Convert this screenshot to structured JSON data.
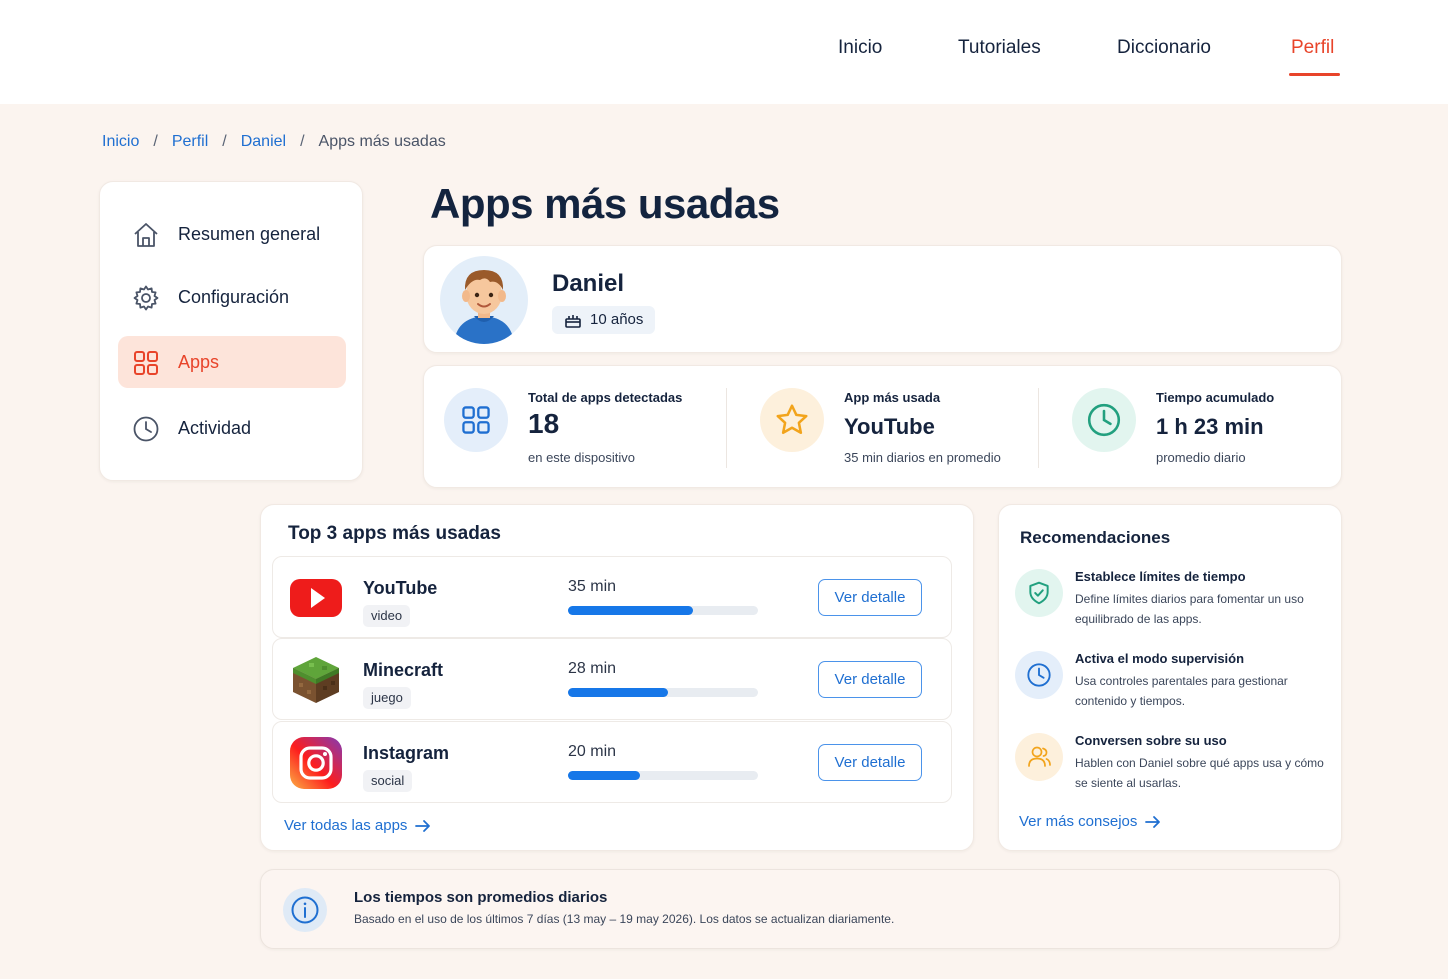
{
  "nav": {
    "items": [
      {
        "label": "Inicio"
      },
      {
        "label": "Tutoriales"
      },
      {
        "label": "Diccionario"
      },
      {
        "label": "Perfil",
        "active": true
      }
    ]
  },
  "breadcrumb": {
    "items": [
      "Inicio",
      "Perfil",
      "Daniel"
    ],
    "current": "Apps más usadas",
    "separator": "/"
  },
  "sidebar": {
    "items": [
      {
        "label": "Resumen general",
        "icon": "home-icon"
      },
      {
        "label": "Configuración",
        "icon": "gear-icon"
      },
      {
        "label": "Apps",
        "icon": "apps-grid-icon",
        "active": true
      },
      {
        "label": "Actividad",
        "icon": "clock-icon"
      }
    ]
  },
  "page": {
    "title": "Apps más usadas"
  },
  "profile": {
    "name": "Daniel",
    "age": "10 años",
    "avatar_icon": "child-avatar-icon"
  },
  "stats": [
    {
      "label": "Total de apps detectadas",
      "value": "18",
      "sub": "en este dispositivo",
      "icon": "apps-grid-icon"
    },
    {
      "label": "App más usada",
      "value": "YouTube",
      "sub": "35 min diarios en promedio",
      "icon": "star-icon"
    },
    {
      "label": "Tiempo acumulado",
      "value": "1 h 23 min",
      "sub": "promedio diario",
      "icon": "clock-icon"
    }
  ],
  "top3": {
    "title": "Top 3 apps más usadas",
    "button_label": "Ver detalle",
    "apps": [
      {
        "name": "YouTube",
        "category": "video",
        "time": "35 min",
        "minutes": 35,
        "icon": "youtube-icon"
      },
      {
        "name": "Minecraft",
        "category": "juego",
        "time": "28 min",
        "minutes": 28,
        "icon": "minecraft-icon"
      },
      {
        "name": "Instagram",
        "category": "social",
        "time": "20 min",
        "minutes": 20,
        "icon": "instagram-icon"
      }
    ],
    "link": "Ver todas las apps"
  },
  "recommendations": {
    "title": "Recomendaciones",
    "items": [
      {
        "title": "Establece límites de tiempo",
        "text": "Define límites diarios para fomentar un uso equilibrado de las apps.",
        "icon": "shield-check-icon"
      },
      {
        "title": "Activa el modo supervisión",
        "text": "Usa controles parentales para gestionar contenido y tiempos.",
        "icon": "clock-icon"
      },
      {
        "title": "Conversen sobre su uso",
        "text": "Hablen con Daniel sobre qué apps usa y cómo se siente al usarlas.",
        "icon": "people-icon"
      }
    ],
    "link": "Ver más consejos"
  },
  "info": {
    "title": "Los tiempos son promedios diarios",
    "text": "Basado en el uso de los últimos 7 días (13 may – 19 may 2026). Los datos se actualizan diariamente.",
    "icon": "info-icon"
  },
  "colors": {
    "accent": "#e8442a",
    "link": "#1f6fd1",
    "bar": "#1677e8",
    "text": "#15233d"
  }
}
